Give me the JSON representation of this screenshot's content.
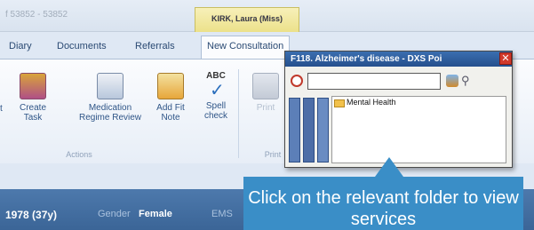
{
  "header": {
    "patient_ids": "f 53852 - 53852",
    "patient_name": "KIRK, Laura (Miss)"
  },
  "tabs": [
    "Diary",
    "Documents",
    "Referrals",
    "New Consultation"
  ],
  "ribbon": {
    "actions": [
      {
        "label_line1": "t",
        "label_line2": ""
      },
      {
        "label_line1": "Create",
        "label_line2": "Task"
      },
      {
        "label_line1": "Medication",
        "label_line2": "Regime Review"
      },
      {
        "label_line1": "Add Fit",
        "label_line2": "Note"
      },
      {
        "label_line1": "Spell",
        "label_line2": "check"
      }
    ],
    "spell_icon_text": "ABC",
    "print_label": "Print",
    "group_actions": "Actions",
    "group_print": "Print"
  },
  "infobar": {
    "dob": "1978 (37y)",
    "gender_label": "Gender",
    "gender_value": "Female",
    "ems_label": "EMS"
  },
  "popup": {
    "title": "F118. Alzheimer's disease - DXS Poi",
    "search_value": "",
    "tree_item": "Mental Health"
  },
  "callout": {
    "text": "Click on the relevant folder to view services"
  },
  "colors": {
    "accent": "#3a8ec7",
    "infobar": "#3b6597",
    "popup_title": "#254f8d"
  }
}
